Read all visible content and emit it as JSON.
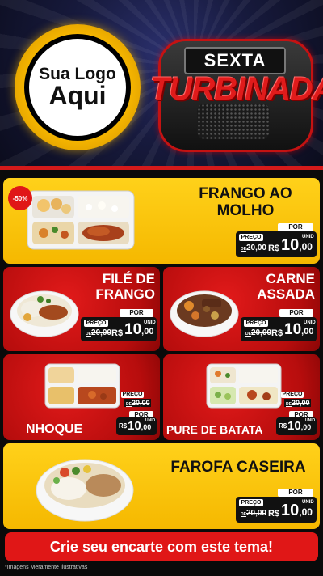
{
  "logo": {
    "line1": "Sua Logo",
    "line2": "Aqui"
  },
  "badge": {
    "line1": "SEXTA",
    "line2": "TURBINADA"
  },
  "discount": "-50%",
  "price_labels": {
    "por": "POR",
    "preco": "PREÇO",
    "de": "DE",
    "rs": "R$",
    "unid": "UNID"
  },
  "items": [
    {
      "name_line1": "FRANGO AO",
      "name_line2": "MOLHO",
      "old_price": "20,00",
      "price_int": "10",
      "price_dec": ",00"
    },
    {
      "name_line1": "FILÉ DE",
      "name_line2": "FRANGO",
      "old_price": "20,00",
      "price_int": "10",
      "price_dec": ",00"
    },
    {
      "name_line1": "CARNE",
      "name_line2": "ASSADA",
      "old_price": "20,00",
      "price_int": "10",
      "price_dec": ",00"
    },
    {
      "name_line1": "NHOQUE",
      "old_price": "20,00",
      "price_int": "10",
      "price_dec": ",00"
    },
    {
      "name_line1": "PURE DE BATATA",
      "old_price": "20,00",
      "price_int": "10",
      "price_dec": ",00"
    },
    {
      "name_line1": "FAROFA CASEIRA",
      "old_price": "20,00",
      "price_int": "10",
      "price_dec": ",00"
    }
  ],
  "cta": "Crie seu encarte com este tema!",
  "disclaimer": "*Imagens Meramente Ilustrativas",
  "colors": {
    "red": "#e01717",
    "yellow": "#ffd11a",
    "dark": "#111111"
  }
}
